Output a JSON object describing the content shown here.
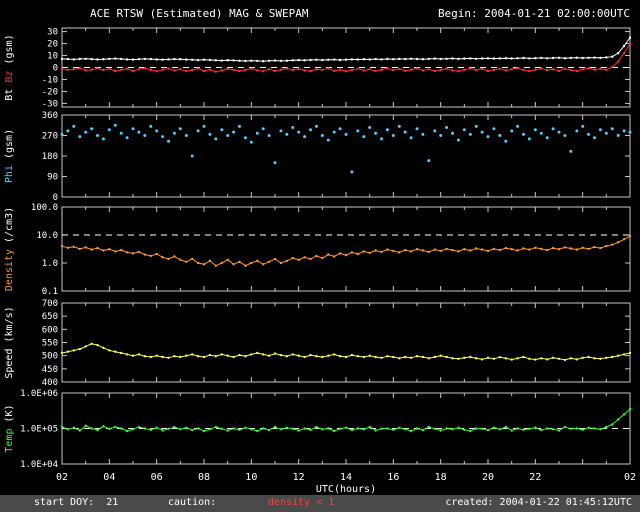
{
  "header": {
    "title": "ACE RTSW (Estimated) MAG & SWEPAM",
    "begin": "Begin: 2004-01-21 02:00:00UTC"
  },
  "footer": {
    "start_doy": "start DOY:  21",
    "caution_label": "caution:",
    "caution_value": "density < 1",
    "created": "created: 2004-01-22 01:45:12UTC"
  },
  "colors": {
    "background": "#000000",
    "frame": "#c8c8c8",
    "tick_text": "#ffffff",
    "reference_line": "#ffffff",
    "bt": "#ffffff",
    "bz": "#ff3030",
    "phi": "#55ccff",
    "density": "#ff9933",
    "speed": "#ffff55",
    "temp": "#33ff33",
    "caution_value": "#ff4040"
  },
  "chart_data": {
    "type": "scatter",
    "title": "ACE RTSW (Estimated) MAG & SWEPAM",
    "xlabel": "UTC(hours)",
    "x": {
      "start_hour": 2,
      "end_hour": 26,
      "step_hours": 0.25
    },
    "x_ticks": [
      {
        "h": 2,
        "label": "02"
      },
      {
        "h": 4,
        "label": "04"
      },
      {
        "h": 6,
        "label": "06"
      },
      {
        "h": 8,
        "label": "08"
      },
      {
        "h": 10,
        "label": "10"
      },
      {
        "h": 12,
        "label": "12"
      },
      {
        "h": 14,
        "label": "14"
      },
      {
        "h": 16,
        "label": "16"
      },
      {
        "h": 18,
        "label": "18"
      },
      {
        "h": 20,
        "label": "20"
      },
      {
        "h": 22,
        "label": "22"
      },
      {
        "h": 24,
        "label": ""
      },
      {
        "h": 26,
        "label": "02"
      }
    ],
    "panels": [
      {
        "id": "bt-bz",
        "yscale": "linear",
        "ylim": [
          -33,
          33
        ],
        "ref_line": 0,
        "yticks": [
          {
            "v": 30,
            "label": "30"
          },
          {
            "v": 20,
            "label": "20"
          },
          {
            "v": 10,
            "label": "10"
          },
          {
            "v": 0,
            "label": "0"
          },
          {
            "v": -10,
            "label": "-10"
          },
          {
            "v": -20,
            "label": "-20"
          },
          {
            "v": -30,
            "label": "-30"
          }
        ],
        "ylabel_parts": [
          {
            "text": "Bt",
            "color": "#ffffff"
          },
          {
            "text": "Bz",
            "color": "#ff3030"
          },
          {
            "text": "(gsm)",
            "color": "#ffffff"
          }
        ],
        "series": [
          {
            "name": "Bt",
            "color": "#ffffff",
            "style": "line-dots",
            "values": [
              7.2,
              7.0,
              6.8,
              7.1,
              7.3,
              7.0,
              6.7,
              6.9,
              7.2,
              7.4,
              7.1,
              6.8,
              6.6,
              6.9,
              7.2,
              7.0,
              6.7,
              6.5,
              6.8,
              7.0,
              6.9,
              6.6,
              6.4,
              6.2,
              6.5,
              6.3,
              6.0,
              5.8,
              6.1,
              5.9,
              5.6,
              5.4,
              5.7,
              5.5,
              5.3,
              5.6,
              5.8,
              5.5,
              5.7,
              6.0,
              6.2,
              6.0,
              6.3,
              6.5,
              6.2,
              6.4,
              6.6,
              6.3,
              6.5,
              6.8,
              6.6,
              6.9,
              6.7,
              7.0,
              6.8,
              7.1,
              6.9,
              7.2,
              7.0,
              7.3,
              7.1,
              6.9,
              7.2,
              7.4,
              7.1,
              7.3,
              7.5,
              7.2,
              7.4,
              7.6,
              7.3,
              7.5,
              7.7,
              7.4,
              7.6,
              7.8,
              7.5,
              7.7,
              7.9,
              7.6,
              7.8,
              8.0,
              7.7,
              7.9,
              8.1,
              7.8,
              8.0,
              8.2,
              7.9,
              8.1,
              8.3,
              8.0,
              8.4,
              9.0,
              12.0,
              18.0,
              25.0
            ]
          },
          {
            "name": "Bz",
            "color": "#ff3030",
            "style": "line-dots",
            "values": [
              -1.0,
              -2.0,
              -1.5,
              -0.5,
              -2.5,
              -1.8,
              -0.8,
              -2.2,
              -1.2,
              -3.0,
              -2.0,
              -1.0,
              -2.8,
              -1.5,
              -0.5,
              -2.0,
              -3.2,
              -1.8,
              -0.8,
              -2.5,
              -1.5,
              -3.0,
              -2.2,
              -1.0,
              -2.8,
              -1.8,
              -3.5,
              -2.5,
              -1.2,
              -2.0,
              -3.0,
              -2.0,
              -1.0,
              -2.5,
              -3.2,
              -1.5,
              -2.8,
              -1.8,
              -0.8,
              -2.2,
              -1.2,
              -2.5,
              -3.0,
              -1.5,
              -2.0,
              -0.8,
              -2.8,
              -1.8,
              -3.2,
              -2.2,
              -1.0,
              -2.5,
              -1.5,
              -3.0,
              -2.0,
              -0.5,
              -2.2,
              -1.2,
              -2.8,
              -1.8,
              -0.8,
              -2.5,
              -1.5,
              -3.0,
              -2.0,
              -1.0,
              -2.5,
              -3.2,
              -1.8,
              -0.8,
              -2.2,
              -1.2,
              -2.8,
              -2.0,
              -1.0,
              -2.5,
              -1.5,
              -0.5,
              -2.0,
              -3.0,
              -1.8,
              -0.8,
              -2.2,
              -1.5,
              -2.8,
              -1.0,
              -2.0,
              -3.0,
              -1.5,
              -0.5,
              -1.8,
              -1.0,
              -2.0,
              0.5,
              5.0,
              12.0,
              20.0
            ]
          }
        ]
      },
      {
        "id": "phi",
        "yscale": "linear",
        "ylim": [
          0,
          360
        ],
        "ref_line": null,
        "yticks": [
          {
            "v": 360,
            "label": "360"
          },
          {
            "v": 270,
            "label": "270"
          },
          {
            "v": 180,
            "label": "180"
          },
          {
            "v": 90,
            "label": "90"
          },
          {
            "v": 0,
            "label": "0"
          }
        ],
        "ylabel_parts": [
          {
            "text": "Phi",
            "color": "#55ccff"
          },
          {
            "text": "(gsm)",
            "color": "#ffffff"
          }
        ],
        "series": [
          {
            "name": "Phi",
            "color": "#55ccff",
            "style": "dots",
            "values": [
              275,
              290,
              310,
              265,
              285,
              300,
              270,
              255,
              295,
              315,
              280,
              260,
              300,
              285,
              270,
              310,
              290,
              265,
              245,
              280,
              300,
              270,
              180,
              290,
              310,
              275,
              255,
              295,
              270,
              285,
              310,
              260,
              240,
              280,
              300,
              270,
              150,
              290,
              275,
              305,
              285,
              265,
              295,
              310,
              270,
              250,
              285,
              300,
              275,
              110,
              290,
              265,
              305,
              280,
              255,
              295,
              270,
              310,
              285,
              260,
              300,
              275,
              160,
              290,
              270,
              305,
              280,
              250,
              295,
              275,
              310,
              285,
              265,
              300,
              270,
              245,
              290,
              310,
              275,
              255,
              295,
              280,
              260,
              300,
              285,
              270,
              200,
              290,
              310,
              275,
              260,
              295,
              280,
              300,
              270,
              290,
              285
            ]
          }
        ]
      },
      {
        "id": "density",
        "yscale": "log",
        "ylim": [
          0.1,
          100
        ],
        "ref_line": 10,
        "yticks": [
          {
            "v": 100,
            "label": "100.0"
          },
          {
            "v": 10,
            "label": "10.0"
          },
          {
            "v": 1,
            "label": "1.0"
          },
          {
            "v": 0.1,
            "label": "0.1"
          }
        ],
        "ylabel_parts": [
          {
            "text": "Density",
            "color": "#ff9933"
          },
          {
            "text": "(/cm3)",
            "color": "#ffffff"
          }
        ],
        "series": [
          {
            "name": "Density",
            "color": "#ff9933",
            "style": "line-dots",
            "values": [
              4.0,
              3.5,
              3.8,
              3.2,
              3.6,
              3.0,
              3.4,
              2.8,
              3.1,
              2.6,
              2.9,
              2.4,
              2.2,
              2.5,
              2.0,
              1.8,
              2.1,
              1.6,
              1.4,
              1.7,
              1.3,
              1.1,
              1.4,
              1.0,
              0.9,
              1.2,
              0.8,
              1.0,
              1.3,
              0.9,
              1.1,
              0.8,
              1.0,
              1.2,
              0.9,
              1.1,
              1.4,
              1.0,
              1.2,
              1.5,
              1.3,
              1.6,
              1.4,
              1.8,
              1.5,
              2.0,
              1.7,
              2.2,
              1.9,
              2.4,
              2.1,
              2.6,
              2.3,
              2.8,
              2.5,
              3.0,
              2.7,
              2.4,
              2.9,
              2.6,
              3.1,
              2.8,
              2.5,
              3.0,
              2.7,
              3.2,
              2.9,
              2.6,
              3.1,
              2.8,
              3.3,
              3.0,
              2.7,
              3.2,
              2.9,
              3.4,
              3.1,
              2.8,
              3.3,
              3.0,
              3.5,
              3.2,
              2.9,
              3.4,
              3.1,
              3.6,
              3.3,
              3.0,
              3.5,
              3.2,
              3.7,
              3.4,
              4.0,
              4.5,
              5.5,
              7.0,
              9.0
            ]
          }
        ]
      },
      {
        "id": "speed",
        "yscale": "linear",
        "ylim": [
          400,
          700
        ],
        "ref_line": null,
        "yticks": [
          {
            "v": 700,
            "label": "700"
          },
          {
            "v": 650,
            "label": "650"
          },
          {
            "v": 600,
            "label": "600"
          },
          {
            "v": 550,
            "label": "550"
          },
          {
            "v": 500,
            "label": "500"
          },
          {
            "v": 450,
            "label": "450"
          },
          {
            "v": 400,
            "label": "400"
          }
        ],
        "ylabel_parts": [
          {
            "text": "Speed",
            "color": "#ffffff"
          },
          {
            "text": "(km/s)",
            "color": "#ffffff"
          }
        ],
        "series": [
          {
            "name": "Speed",
            "color": "#ffff55",
            "style": "line-dots",
            "values": [
              510,
              515,
              520,
              525,
              535,
              545,
              540,
              530,
              520,
              515,
              510,
              505,
              500,
              505,
              498,
              495,
              500,
              495,
              492,
              498,
              495,
              500,
              505,
              498,
              495,
              502,
              498,
              505,
              500,
              495,
              502,
              498,
              505,
              510,
              505,
              500,
              508,
              502,
              498,
              505,
              500,
              495,
              502,
              498,
              495,
              500,
              505,
              498,
              495,
              502,
              498,
              495,
              500,
              495,
              492,
              498,
              495,
              490,
              495,
              492,
              498,
              495,
              490,
              495,
              500,
              495,
              490,
              488,
              492,
              495,
              490,
              486,
              492,
              488,
              494,
              490,
              485,
              490,
              495,
              488,
              485,
              490,
              486,
              492,
              488,
              484,
              490,
              486,
              492,
              495,
              490,
              488,
              492,
              495,
              500,
              505,
              510
            ]
          }
        ]
      },
      {
        "id": "temp",
        "yscale": "log",
        "ylim": [
          10000,
          1000000
        ],
        "ref_line": 100000,
        "yticks": [
          {
            "v": 1000000,
            "label": "1.0E+06"
          },
          {
            "v": 100000,
            "label": "1.0E+05"
          },
          {
            "v": 10000,
            "label": "1.0E+04"
          }
        ],
        "ylabel_parts": [
          {
            "text": "Temp",
            "color": "#33ff33"
          },
          {
            "text": "(K)",
            "color": "#ffffff"
          }
        ],
        "series": [
          {
            "name": "Temp",
            "color": "#33ff33",
            "style": "line-dots",
            "values": [
              110000,
              95000,
              105000,
              88000,
              120000,
              100000,
              90000,
              115000,
              98000,
              110000,
              100000,
              85000,
              95000,
              110000,
              100000,
              92000,
              105000,
              88000,
              98000,
              110000,
              95000,
              105000,
              90000,
              100000,
              85000,
              95000,
              110000,
              98000,
              88000,
              100000,
              92000,
              105000,
              95000,
              85000,
              100000,
              90000,
              110000,
              95000,
              105000,
              98000,
              88000,
              100000,
              92000,
              110000,
              95000,
              100000,
              85000,
              98000,
              105000,
              90000,
              100000,
              95000,
              110000,
              88000,
              98000,
              100000,
              92000,
              105000,
              95000,
              85000,
              100000,
              90000,
              110000,
              98000,
              88000,
              100000,
              95000,
              105000,
              92000,
              85000,
              100000,
              98000,
              90000,
              105000,
              95000,
              110000,
              88000,
              100000,
              92000,
              98000,
              105000,
              90000,
              100000,
              95000,
              88000,
              110000,
              98000,
              100000,
              92000,
              105000,
              100000,
              95000,
              110000,
              130000,
              180000,
              250000,
              350000
            ]
          }
        ]
      }
    ]
  }
}
